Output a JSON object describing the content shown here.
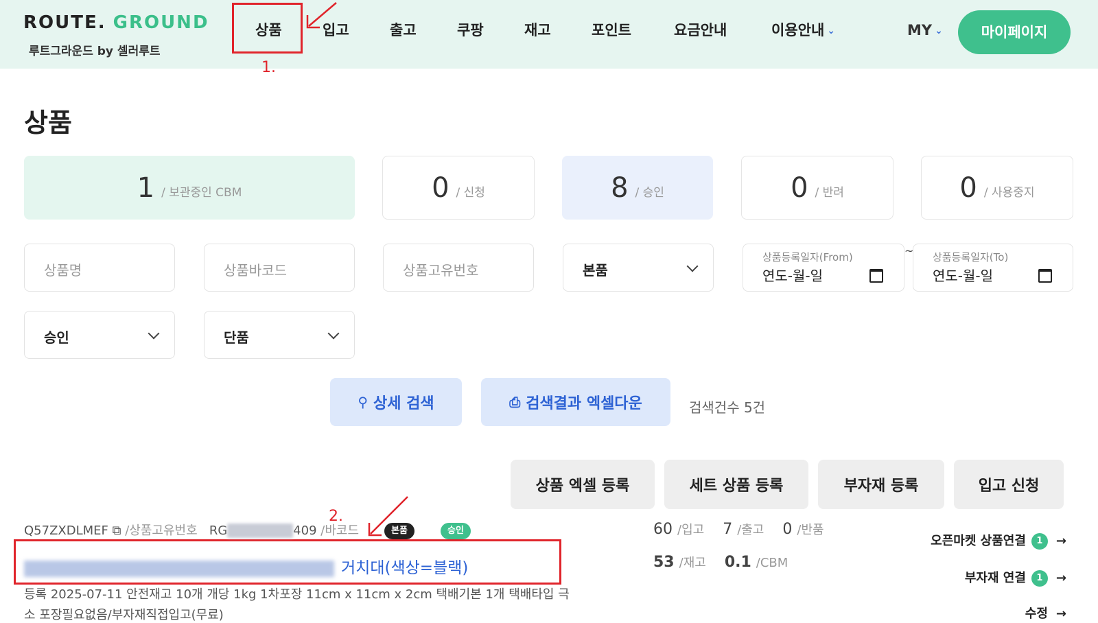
{
  "header": {
    "logo_route": "ROUTE.",
    "logo_ground": "GROUND",
    "logo_sub": "루트그라운드 by 셀러루트",
    "nav": [
      "상품",
      "입고",
      "출고",
      "쿠팡",
      "재고",
      "포인트",
      "요금안내",
      "이용안내"
    ],
    "my": "MY",
    "mypage": "마이페이지"
  },
  "annotations": {
    "step1": "1.",
    "step2": "2."
  },
  "page_title": "상품",
  "stats": [
    {
      "num": "1",
      "label": "/ 보관중인 CBM"
    },
    {
      "num": "0",
      "label": "/ 신청"
    },
    {
      "num": "8",
      "label": "/ 승인"
    },
    {
      "num": "0",
      "label": "/ 반려"
    },
    {
      "num": "0",
      "label": "/ 사용중지"
    }
  ],
  "filters": {
    "name_ph": "상품명",
    "barcode_ph": "상품바코드",
    "uid_ph": "상품고유번호",
    "type": "본품",
    "date_from_label": "상품등록일자(From)",
    "date_to_label": "상품등록일자(To)",
    "date_ph": "연도-월-일",
    "tilde": "~",
    "status": "승인",
    "unit": "단품"
  },
  "actions": {
    "search": "상세 검색",
    "excel_down": "검색결과 엑셀다운",
    "count": "검색건수 5건",
    "excel_reg": "상품 엑셀 등록",
    "set_reg": "세트 상품 등록",
    "sub_reg": "부자재 등록",
    "inbound_req": "입고 신청"
  },
  "product": {
    "uid": "Q57ZXDLMEF",
    "uid_label": "/상품고유번호",
    "barcode_prefix": "RG",
    "barcode_suffix": "409",
    "barcode_label": "/바코드",
    "badge_type": "본품",
    "badge_status": "승인",
    "name_visible": "거치대(색상=블랙)",
    "detail": "등록 2025-07-11   안전재고 10개   개당 1kg   1차포장 11cm x 11cm x 2cm   택배기본 1개   택배타입 극",
    "detail2": "소   포장필요없음/부자재직접입고(무료)",
    "inbound": "60",
    "inbound_label": "/입고",
    "outbound": "7",
    "outbound_label": "/출고",
    "returned": "0",
    "returned_label": "/반품",
    "stock": "53",
    "stock_label": "/재고",
    "cbm": "0.1",
    "cbm_label": "/CBM",
    "link_openmarket": "오픈마켓 상품연결",
    "link_openmarket_count": "1",
    "link_sub": "부자재 연결",
    "link_sub_count": "1",
    "edit": "수정"
  },
  "colors": {
    "accent": "#3fc08d",
    "header_bg": "#e6f5f0",
    "link_blue": "#2d62d4",
    "annotation_red": "#e0242b"
  }
}
